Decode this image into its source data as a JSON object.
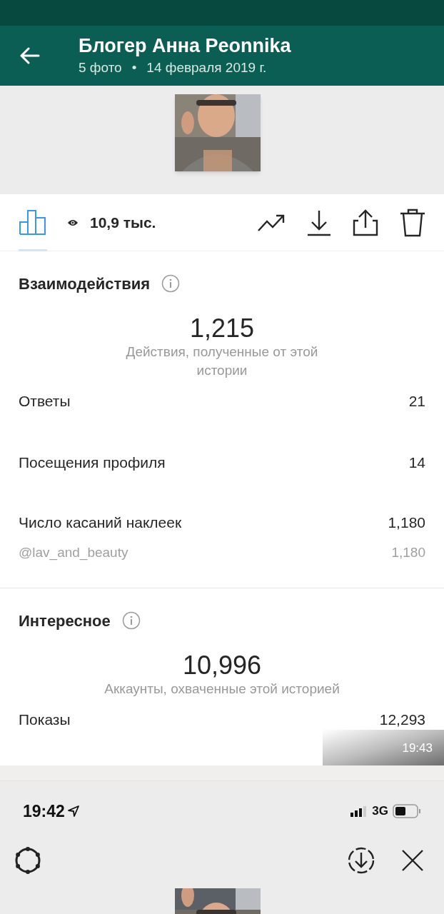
{
  "app_bar": {
    "title": "Блогер Анна Peonnika",
    "photo_count": "5 фото",
    "separator": "•",
    "date": "14 февраля 2019 г."
  },
  "story_toolbar": {
    "stats_tab": {
      "selected": true
    },
    "views": "10,9 тыс."
  },
  "interactions": {
    "title": "Взаимодействия",
    "total": "1,215",
    "caption": "Действия, полученные от этой истории",
    "rows": [
      {
        "kind": "main",
        "label": "Ответы",
        "value": "21"
      },
      {
        "kind": "main",
        "label": "Посещения профиля",
        "value": "14"
      },
      {
        "kind": "main",
        "label": "Число касаний наклеек",
        "value": "1,180"
      },
      {
        "kind": "sub",
        "label": "@lav_and_beauty",
        "value": "1,180"
      }
    ]
  },
  "discovery": {
    "title": "Интересное",
    "total": "10,996",
    "caption": "Аккаунты, охваченные этой историей",
    "rows": [
      {
        "label": "Показы",
        "value": "12,293"
      }
    ]
  },
  "timestamp": "19:43",
  "second_screen": {
    "status_time": "19:42",
    "network": "3G"
  }
}
